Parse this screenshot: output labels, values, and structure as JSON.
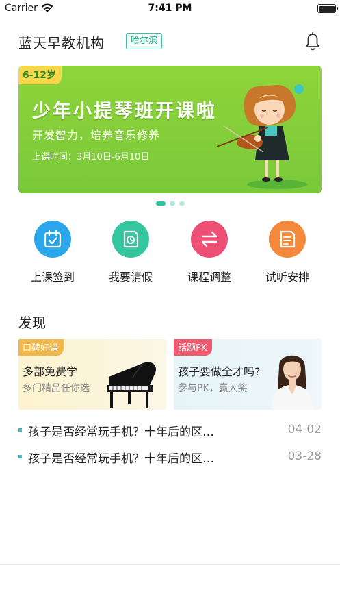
{
  "status_bar": {
    "carrier": "Carrier",
    "time": "7:41 PM"
  },
  "header": {
    "title": "蓝天早教机构",
    "city": "哈尔滨"
  },
  "banner": {
    "age_tag": "6-12岁",
    "title": "少年小提琴班开课啦",
    "subtitle": "开发智力，培养音乐修养",
    "schedule": "上课时间：3月10日-6月10日",
    "page_count": 3,
    "active_page": 1
  },
  "quick_actions": [
    {
      "label": "上课签到",
      "icon": "calendar-check-icon",
      "color": "#2ba6ea"
    },
    {
      "label": "我要请假",
      "icon": "leave-request-icon",
      "color": "#35c59f"
    },
    {
      "label": "课程调整",
      "icon": "swap-arrows-icon",
      "color": "#ee4f75"
    },
    {
      "label": "试听安排",
      "icon": "audition-schedule-icon",
      "color": "#f4883d"
    }
  ],
  "discover": {
    "title": "发现",
    "cards": [
      {
        "tag": "口碑好课",
        "title": "多部免费学",
        "subtitle": "多门精品任你选",
        "tag_color": "#f0b84a"
      },
      {
        "tag": "話题PK",
        "title": "孩子要做全才吗?",
        "subtitle": "参与PK，赢大奖",
        "tag_color": "#f05a6e"
      }
    ]
  },
  "news": [
    {
      "title": "孩子是否经常玩手机？十年后的区…",
      "date": "04-02"
    },
    {
      "title": "孩子是否经常玩手机？十年后的区…",
      "date": "03-28"
    }
  ]
}
